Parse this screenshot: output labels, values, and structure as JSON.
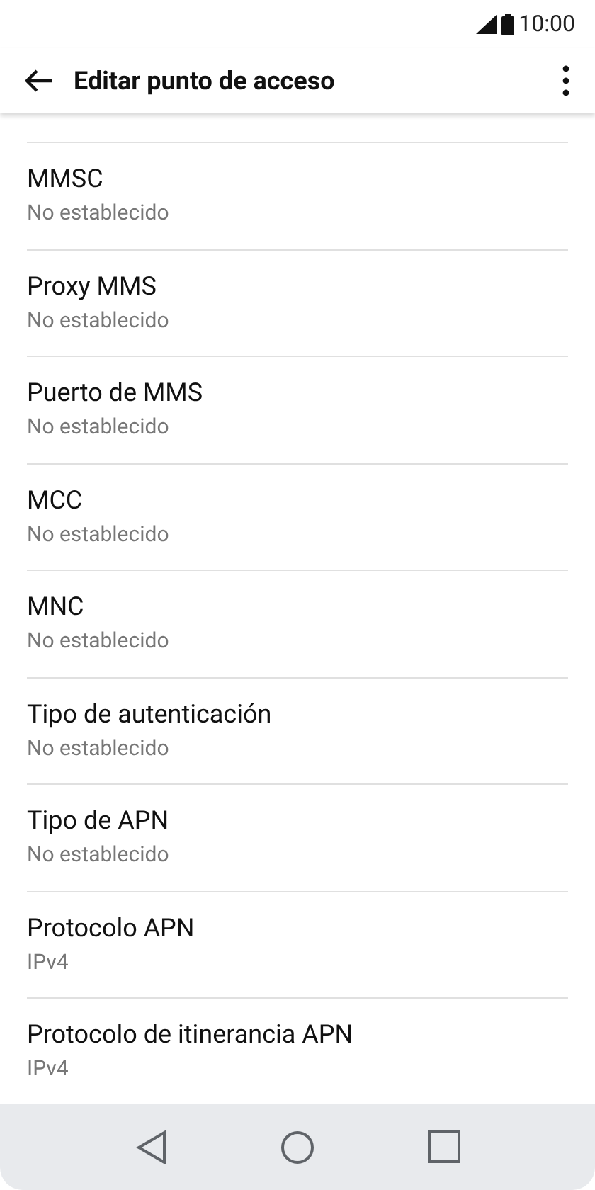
{
  "status_bar": {
    "time": "10:00"
  },
  "header": {
    "title": "Editar punto de acceso"
  },
  "settings": [
    {
      "label": "MMSC",
      "value": "No establecido"
    },
    {
      "label": "Proxy MMS",
      "value": "No establecido"
    },
    {
      "label": "Puerto de MMS",
      "value": "No establecido"
    },
    {
      "label": "MCC",
      "value": "No establecido"
    },
    {
      "label": "MNC",
      "value": "No establecido"
    },
    {
      "label": "Tipo de autenticación",
      "value": "No establecido"
    },
    {
      "label": "Tipo de APN",
      "value": "No establecido"
    },
    {
      "label": "Protocolo APN",
      "value": "IPv4"
    },
    {
      "label": "Protocolo de itinerancia APN",
      "value": "IPv4"
    }
  ]
}
